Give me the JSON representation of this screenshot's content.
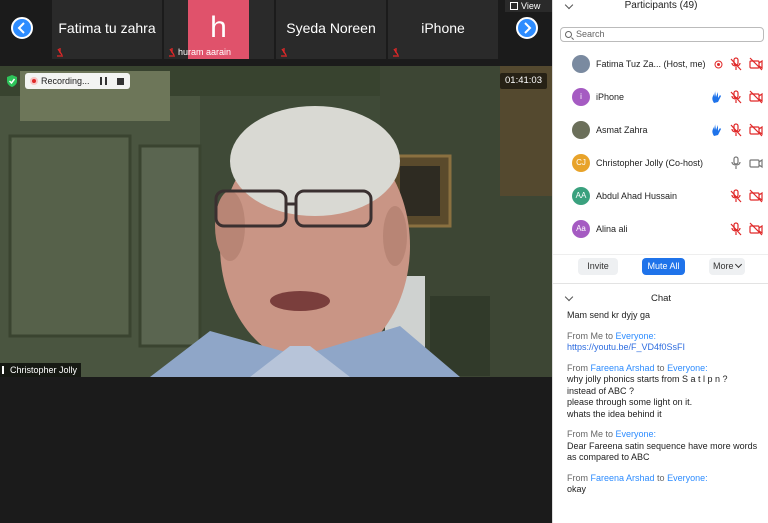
{
  "gallery_strip": {
    "tiles": [
      {
        "name": "Fatima tu zahra"
      },
      {
        "name": "huram aarain",
        "initial": "h"
      },
      {
        "name": "Syeda Noreen"
      },
      {
        "name": "iPhone"
      }
    ],
    "view_label": "View"
  },
  "speaker": {
    "recording_label": "Recording...",
    "timer": "01:41:03",
    "name_label": "Christopher Jolly"
  },
  "participants": {
    "title": "Participants (49)",
    "search_placeholder": "Search",
    "list": [
      {
        "name": "Fatima Tuz Za...",
        "role": "(Host, me)",
        "avatar_initials": "",
        "avatar_color": "#7a8aa0",
        "hand_raised": false,
        "mic": "muted",
        "video": "off",
        "recording": true
      },
      {
        "name": "iPhone",
        "role": "",
        "avatar_initials": "i",
        "avatar_color": "#a55bc2",
        "hand_raised": true,
        "mic": "muted",
        "video": "off",
        "recording": false
      },
      {
        "name": "Asmat Zahra",
        "role": "",
        "avatar_initials": "",
        "avatar_color": "#6b6f5a",
        "hand_raised": true,
        "mic": "muted",
        "video": "off",
        "recording": false
      },
      {
        "name": "Christopher Jolly",
        "role": "(Co-host)",
        "avatar_initials": "CJ",
        "avatar_color": "#e8a32a",
        "hand_raised": false,
        "mic": "on",
        "video": "on",
        "recording": false
      },
      {
        "name": "Abdul Ahad Hussain",
        "role": "",
        "avatar_initials": "AA",
        "avatar_color": "#3aa17e",
        "hand_raised": false,
        "mic": "muted",
        "video": "off",
        "recording": false
      },
      {
        "name": "Alina ali",
        "role": "",
        "avatar_initials": "Aa",
        "avatar_color": "#a55bc2",
        "hand_raised": false,
        "mic": "muted",
        "video": "off",
        "recording": false
      }
    ],
    "buttons": {
      "invite": "Invite",
      "mute_all": "Mute All",
      "more": "More"
    }
  },
  "chat": {
    "title": "Chat",
    "messages": [
      {
        "from": "",
        "from_sep": "",
        "to": "",
        "lines": [
          "Mam send kr dyjy ga"
        ]
      },
      {
        "from": "From Me",
        "from_sep": " to ",
        "to": "Everyone:",
        "lines": [
          "https://youtu.be/F_VD4f0SsFI"
        ],
        "is_link": true
      },
      {
        "from": "From ",
        "from_name": "Fareena Arshad",
        "from_sep": " to ",
        "to": "Everyone:",
        "lines": [
          "why jolly phonics starts from S a t l p n ?",
          "instead of ABC ?",
          "please through some light on it.",
          "whats the idea behind it"
        ]
      },
      {
        "from": "From Me",
        "from_sep": " to ",
        "to": "Everyone:",
        "lines": [
          "Dear Fareena satin sequence have more words as compared to ABC"
        ]
      },
      {
        "from": "From ",
        "from_name": "Fareena Arshad",
        "from_sep": " to ",
        "to": "Everyone:",
        "lines": [
          "okay"
        ]
      }
    ]
  },
  "colors": {
    "accent": "#2d8cff",
    "mute_red": "#e02828",
    "hand_blue": "#1f73ea"
  }
}
